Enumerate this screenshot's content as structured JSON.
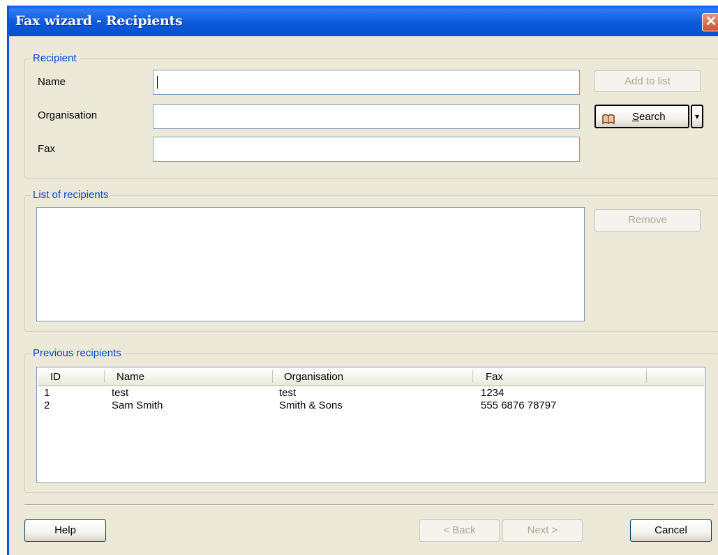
{
  "window": {
    "title": "Fax wizard - Recipients",
    "close": "✕"
  },
  "recipient": {
    "legend": "Recipient",
    "name_label": "Name",
    "organisation_label": "Organisation",
    "fax_label": "Fax",
    "name_value": "",
    "organisation_value": "",
    "fax_value": "",
    "add_button": "Add to list",
    "search_prefix": "",
    "search_hotkey": "S",
    "search_rest": "earch",
    "search_dropdown": "▾"
  },
  "list": {
    "legend": "List of recipients",
    "remove_button": "Remove"
  },
  "previous": {
    "legend": "Previous recipients",
    "columns": [
      "ID",
      "Name",
      "Organisation",
      "Fax"
    ],
    "rows": [
      [
        "1",
        "test",
        "test",
        "1234"
      ],
      [
        "2",
        "Sam Smith",
        "Smith  & Sons",
        "555 6876 78797"
      ]
    ]
  },
  "footer": {
    "help": "Help",
    "back": "< Back",
    "next": "Next >",
    "cancel": "Cancel"
  },
  "colors": {
    "titlebar": "#0A5CE8",
    "dialog_bg": "#ECE9D8",
    "legend_text": "#0046D5"
  }
}
